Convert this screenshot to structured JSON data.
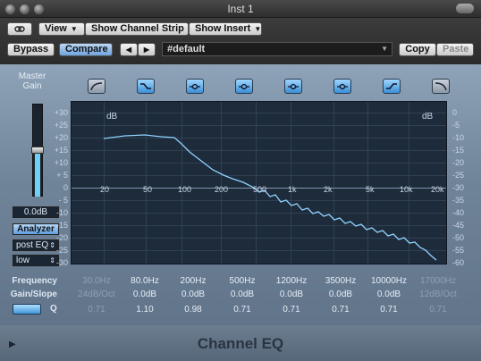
{
  "window": {
    "title": "Inst 1"
  },
  "toolbar": {
    "view_label": "View",
    "show_channel_strip_label": "Show Channel Strip",
    "show_insert_label": "Show Insert",
    "bypass_label": "Bypass",
    "compare_label": "Compare",
    "prev_label": "◀",
    "next_label": "▶",
    "preset_value": "#default",
    "copy_label": "Copy",
    "paste_label": "Paste"
  },
  "left_panel": {
    "master_gain_label_1": "Master",
    "master_gain_label_2": "Gain",
    "master_gain_value": "0.0dB",
    "master_gain_level": 0.5,
    "analyzer_label": "Analyzer",
    "analyzer_mode": "post EQ",
    "analyzer_resolution": "low"
  },
  "graph": {
    "db_unit_left": "dB",
    "db_unit_right": "dB",
    "left_ticks": [
      "+30",
      "+25",
      "+20",
      "+15",
      "+10",
      "+ 5",
      "0",
      "- 5",
      "-10",
      "-15",
      "-20",
      "-25",
      "-30"
    ],
    "right_ticks": [
      "0",
      "-5",
      "-10",
      "-15",
      "-20",
      "-25",
      "-30",
      "-35",
      "-40",
      "-45",
      "-50",
      "-55",
      "-60"
    ],
    "freq_ticks": [
      "20",
      "50",
      "100",
      "200",
      "500",
      "1k",
      "2k",
      "5k",
      "10k",
      "20k"
    ]
  },
  "params": {
    "frequency_label": "Frequency",
    "gain_slope_label": "Gain/Slope",
    "q_label": "Q",
    "bands": [
      {
        "frequency": "30.0Hz",
        "gain": "24dB/Oct",
        "q": "0.71",
        "enabled": false
      },
      {
        "frequency": "80.0Hz",
        "gain": "0.0dB",
        "q": "1.10",
        "enabled": true
      },
      {
        "frequency": "200Hz",
        "gain": "0.0dB",
        "q": "0.98",
        "enabled": true
      },
      {
        "frequency": "500Hz",
        "gain": "0.0dB",
        "q": "0.71",
        "enabled": true
      },
      {
        "frequency": "1200Hz",
        "gain": "0.0dB",
        "q": "0.71",
        "enabled": true
      },
      {
        "frequency": "3500Hz",
        "gain": "0.0dB",
        "q": "0.71",
        "enabled": true
      },
      {
        "frequency": "10000Hz",
        "gain": "0.0dB",
        "q": "0.71",
        "enabled": true
      },
      {
        "frequency": "17000Hz",
        "gain": "12dB/Oct",
        "q": "0.71",
        "enabled": false
      }
    ]
  },
  "footer": {
    "plugin_name": "Channel EQ"
  },
  "colors": {
    "accent": "#5ea4e4",
    "analyzer_trace": "#8fd3ff",
    "graph_bg": "#1e2b3a"
  }
}
